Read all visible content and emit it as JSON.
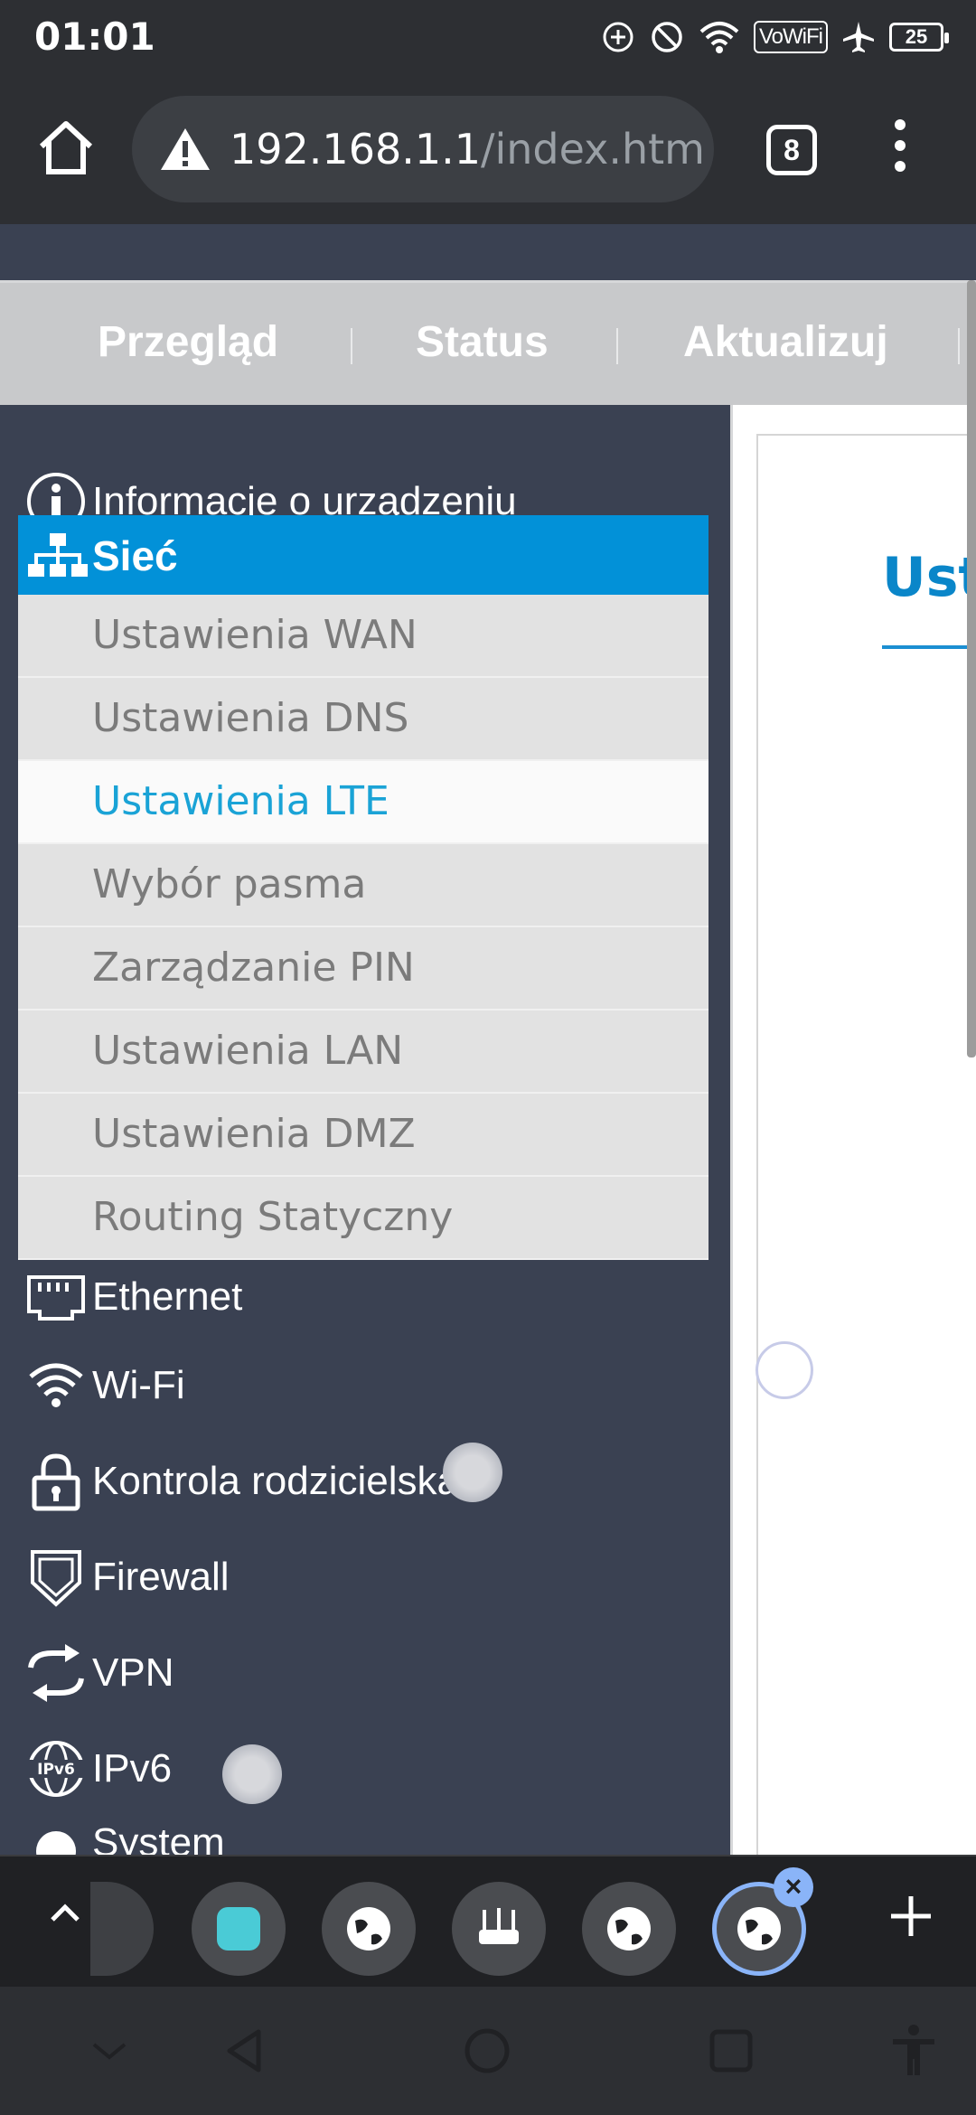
{
  "status_bar": {
    "time": "01:01",
    "vowifi": "VoWiFi",
    "battery": "25"
  },
  "browser": {
    "url_host": "192.168.1.1",
    "url_path": "/index.htm",
    "tab_count": "8"
  },
  "top_nav": {
    "items": [
      "Przegląd",
      "Status",
      "Aktualizuj"
    ]
  },
  "sidebar": {
    "device_info": "Informacje o urządzeniu",
    "network": "Sieć",
    "network_sub": [
      "Ustawienia WAN",
      "Ustawienia DNS",
      "Ustawienia LTE",
      "Wybór pasma",
      "Zarządzanie PIN",
      "Ustawienia LAN",
      "Ustawienia DMZ",
      "Routing Statyczny"
    ],
    "active_sub_index": 2,
    "ethernet": "Ethernet",
    "wifi": "Wi-Fi",
    "parental": "Kontrola rodzicielska",
    "firewall": "Firewall",
    "vpn": "VPN",
    "ipv6": "IPv6",
    "system": "System"
  },
  "content": {
    "title_partial": "Usta"
  },
  "colors": {
    "accent": "#0291d8",
    "active_text": "#1aa3d6",
    "sidebar_bg": "#3a4152"
  }
}
